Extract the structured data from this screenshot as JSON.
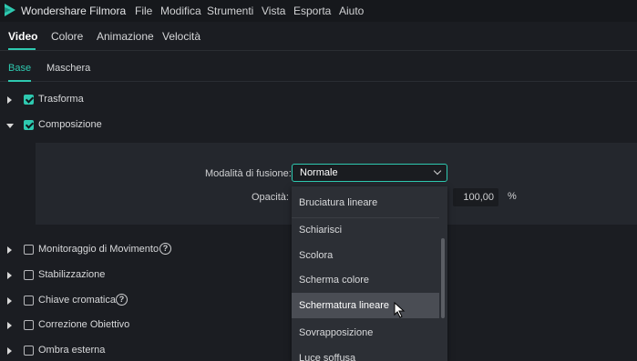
{
  "app": {
    "title": "Wondershare Filmora"
  },
  "menu": [
    "File",
    "Modifica",
    "Strumenti",
    "Vista",
    "Esporta",
    "Aiuto"
  ],
  "tabs": [
    "Video",
    "Colore",
    "Animazione",
    "Velocità"
  ],
  "subtabs": [
    "Base",
    "Maschera"
  ],
  "sections": {
    "transform": "Trasforma",
    "composition": "Composizione",
    "motion_tracking": "Monitoraggio di Movimento",
    "stabilization": "Stabilizzazione",
    "chroma_key": "Chiave cromatica",
    "lens_correction": "Correzione Obiettivo",
    "drop_shadow": "Ombra esterna"
  },
  "composition": {
    "blend_label": "Modalità di fusione:",
    "blend_value": "Normale",
    "opacity_label": "Opacità:",
    "opacity_value": "100,00",
    "opacity_unit": "%"
  },
  "dropdown": {
    "items": [
      "Bruciatura lineare",
      "Schiarisci",
      "Scolora",
      "Scherma colore",
      "Schermatura lineare",
      "Sovrapposizione",
      "Luce soffusa"
    ],
    "hovered": "Schermatura lineare"
  },
  "help_glyph": "?",
  "colors": {
    "accent": "#2ec9b0",
    "background": "#1b1d22",
    "panel": "#24272d"
  }
}
